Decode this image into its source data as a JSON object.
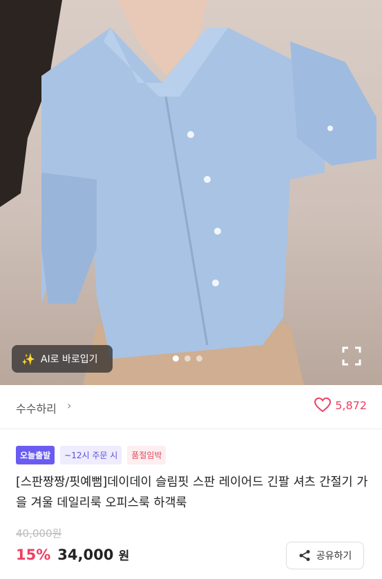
{
  "hero": {
    "ai_button_label": "AI로 바로입기",
    "carousel_dot_count": 3,
    "active_slide": 1
  },
  "seller": {
    "name": "수수하리",
    "like_count": "5,872"
  },
  "badges": {
    "today": "오늘출발",
    "cutoff": "~12시 주문 시",
    "status": "품절임박"
  },
  "product": {
    "title": "[스판짱짱/핏예뻠]데이데이 슬림핏 스판 레이어드 긴팔 셔츠 간절기 가을 겨울 데일리룩 오피스룩 하객룩",
    "original_price": "40,000원",
    "discount": "15%",
    "price": "34,000",
    "currency": "원"
  },
  "share": {
    "label": "공유하기"
  },
  "colors": {
    "accent_pink": "#ef3e62",
    "badge_purple": "#6a5cf0"
  }
}
